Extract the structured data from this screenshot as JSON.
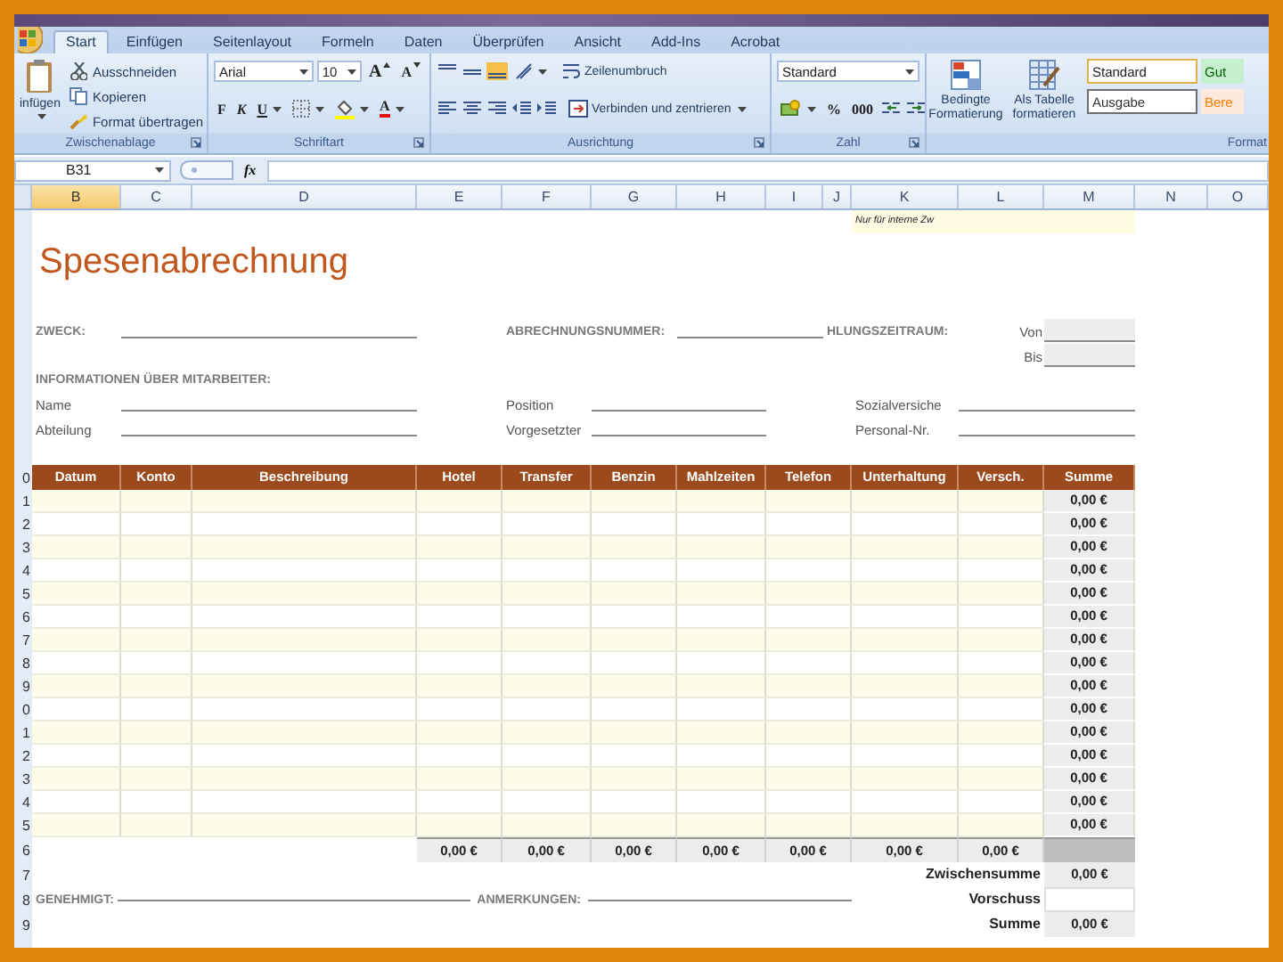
{
  "ribbon": {
    "tabs": [
      {
        "label": "Start",
        "selected": true
      },
      {
        "label": "Einfügen",
        "selected": false
      },
      {
        "label": "Seitenlayout",
        "selected": false
      },
      {
        "label": "Formeln",
        "selected": false
      },
      {
        "label": "Daten",
        "selected": false
      },
      {
        "label": "Überprüfen",
        "selected": false
      },
      {
        "label": "Ansicht",
        "selected": false
      },
      {
        "label": "Add-Ins",
        "selected": false
      },
      {
        "label": "Acrobat",
        "selected": false
      }
    ],
    "clipboard": {
      "label": "Zwischenablage",
      "paste": "infügen",
      "actions": [
        "Ausschneiden",
        "Kopieren",
        "Format übertragen"
      ]
    },
    "font": {
      "label": "Schriftart",
      "font_name": "Arial",
      "font_size": "10",
      "grow": "A",
      "shrink": "A",
      "bold": "F",
      "italic": "K",
      "underline": "U",
      "color_letter": "A"
    },
    "alignment": {
      "label": "Ausrichtung",
      "wrap": "Zeilenumbruch",
      "merge": "Verbinden und zentrieren"
    },
    "number": {
      "label": "Zahl",
      "format": "Standard",
      "percent": "%",
      "thousands": "000"
    },
    "styles": {
      "label": "Format",
      "conditional": "Bedingte Formatierung",
      "as_table": "Als Tabelle formatieren",
      "cell_styles": [
        {
          "label": "Standard",
          "kind": "normal"
        },
        {
          "label": "Gut",
          "kind": "good"
        },
        {
          "label": "Ausgabe",
          "kind": "output"
        },
        {
          "label": "Bere",
          "kind": "calculation"
        }
      ]
    }
  },
  "formula_bar": {
    "name_box": "B31",
    "fx": "fx"
  },
  "sheet": {
    "columns": [
      {
        "label": "B",
        "selected": true
      },
      {
        "label": "C",
        "selected": false
      },
      {
        "label": "D",
        "selected": false
      },
      {
        "label": "E",
        "selected": false
      },
      {
        "label": "F",
        "selected": false
      },
      {
        "label": "G",
        "selected": false
      },
      {
        "label": "H",
        "selected": false
      },
      {
        "label": "I",
        "selected": false
      },
      {
        "label": "J",
        "selected": false
      },
      {
        "label": "K",
        "selected": false
      },
      {
        "label": "L",
        "selected": false
      },
      {
        "label": "M",
        "selected": false
      },
      {
        "label": "N",
        "selected": false
      },
      {
        "label": "O",
        "selected": false
      }
    ],
    "internal_note": "Nur für interne Zw",
    "title": "Spesenabrechnung",
    "purpose_label": "ZWECK:",
    "report_number_label": "ABRECHNUNGSNUMMER:",
    "period_label": "HLUNGSZEITRAUM:",
    "from_label": "Von",
    "to_label": "Bis",
    "employee_heading": "INFORMATIONEN ÜBER MITARBEITER:",
    "employee_rows": [
      [
        "Name",
        "Position",
        "Sozialversiche"
      ],
      [
        "Abteilung",
        "Vorgesetzter",
        "Personal-Nr."
      ]
    ],
    "table": {
      "header_row_number": "0",
      "columns": [
        "Datum",
        "Konto",
        "Beschreibung",
        "Hotel",
        "Transfer",
        "Benzin",
        "Mahlzeiten",
        "Telefon",
        "Unterhaltung",
        "Versch.",
        "Summe"
      ],
      "rows": [
        {
          "row_number": "1",
          "total": "0,00 €"
        },
        {
          "row_number": "2",
          "total": "0,00 €"
        },
        {
          "row_number": "3",
          "total": "0,00 €"
        },
        {
          "row_number": "4",
          "total": "0,00 €"
        },
        {
          "row_number": "5",
          "total": "0,00 €"
        },
        {
          "row_number": "6",
          "total": "0,00 €"
        },
        {
          "row_number": "7",
          "total": "0,00 €"
        },
        {
          "row_number": "8",
          "total": "0,00 €"
        },
        {
          "row_number": "9",
          "total": "0,00 €"
        },
        {
          "row_number": "0",
          "total": "0,00 €"
        },
        {
          "row_number": "1",
          "total": "0,00 €"
        },
        {
          "row_number": "2",
          "total": "0,00 €"
        },
        {
          "row_number": "3",
          "total": "0,00 €"
        },
        {
          "row_number": "4",
          "total": "0,00 €"
        },
        {
          "row_number": "5",
          "total": "0,00 €"
        }
      ],
      "totals": {
        "row_number": "6",
        "values": [
          "0,00 €",
          "0,00 €",
          "0,00 €",
          "0,00 €",
          "0,00 €",
          "0,00 €",
          "0,00 €"
        ]
      },
      "summary": [
        {
          "row_number": "7",
          "label": "Zwischensumme",
          "value": "0,00 €"
        },
        {
          "row_number": "8",
          "label": "Vorschuss"
        },
        {
          "row_number": "9",
          "label": "Summe",
          "value": "0,00 €"
        }
      ]
    },
    "approved_label": "GENEHMIGT:",
    "notes_label": "ANMERKUNGEN:"
  }
}
